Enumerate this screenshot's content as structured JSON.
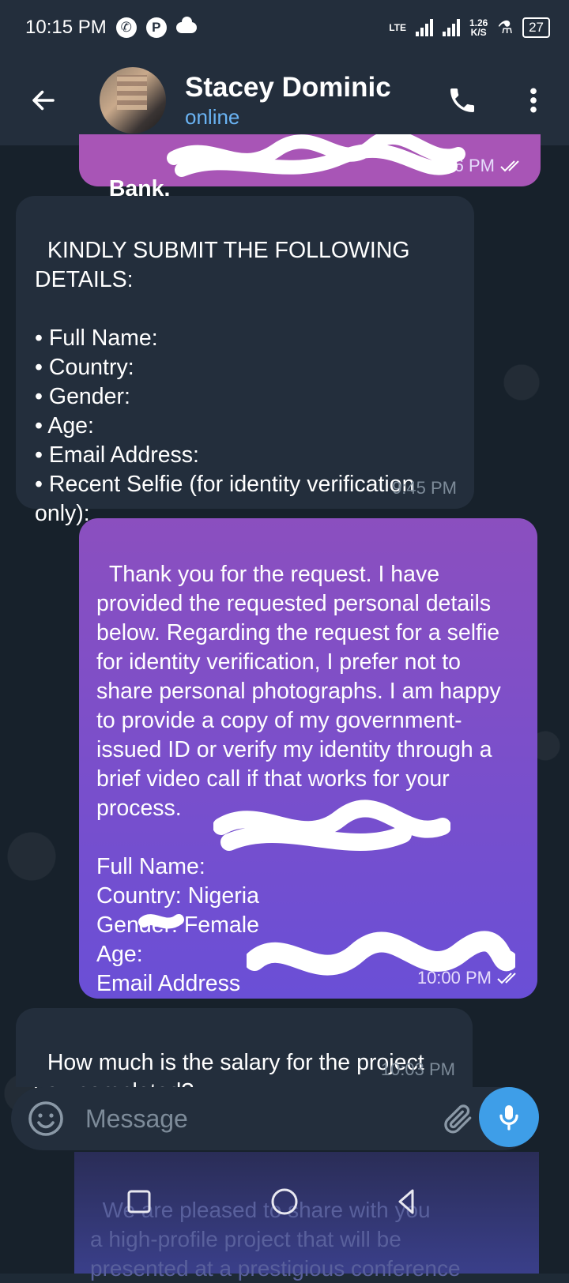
{
  "status_bar": {
    "time": "10:15 PM",
    "network_label": "LTE",
    "speed_value": "1.26",
    "speed_unit": "K/S",
    "battery": "27"
  },
  "header": {
    "contact_name": "Stacey Dominic",
    "contact_status": "online",
    "icons": {
      "back": "back-arrow-icon",
      "call": "phone-icon",
      "menu": "more-vertical-icon"
    }
  },
  "messages": [
    {
      "direction": "outgoing",
      "text": "Bank.",
      "time": "9:36 PM",
      "read": true
    },
    {
      "direction": "incoming",
      "text": "KINDLY SUBMIT THE FOLLOWING DETAILS:\n\n• Full Name:\n• Country:\n• Gender:\n• Age:\n• Email Address:\n• Recent Selfie (for identity verification only):",
      "time": "9:45 PM"
    },
    {
      "direction": "outgoing",
      "text": "Thank you for the request. I have provided the requested personal details below. Regarding the request for a selfie for identity verification, I prefer not to share personal photographs. I am happy to provide a copy of my government-issued ID or verify my identity through a brief video call if that works for your process.\n\nFull Name:\nCountry: Nigeria\nGender: Female\nAge:\nEmail Address",
      "time": "10:00 PM",
      "read": true
    },
    {
      "direction": "incoming",
      "text": "How much is the salary for the project you completed?",
      "time": "10:03 PM"
    }
  ],
  "composer": {
    "placeholder": "Message",
    "icons": {
      "emoji": "emoji-icon",
      "attach": "paperclip-icon",
      "mic": "microphone-icon"
    }
  },
  "preview_text": "We are pleased to share with you\na high-profile project that will be\npresented at a prestigious conference",
  "colors": {
    "header_bg": "#232e3c",
    "chat_bg": "#17212b",
    "incoming_bubble": "#232e3c",
    "outgoing_bubble_top": "#8b4fbf",
    "outgoing_bubble_bottom": "#6a4fd6",
    "accent": "#3e9ee8",
    "online": "#6ab3f3"
  }
}
